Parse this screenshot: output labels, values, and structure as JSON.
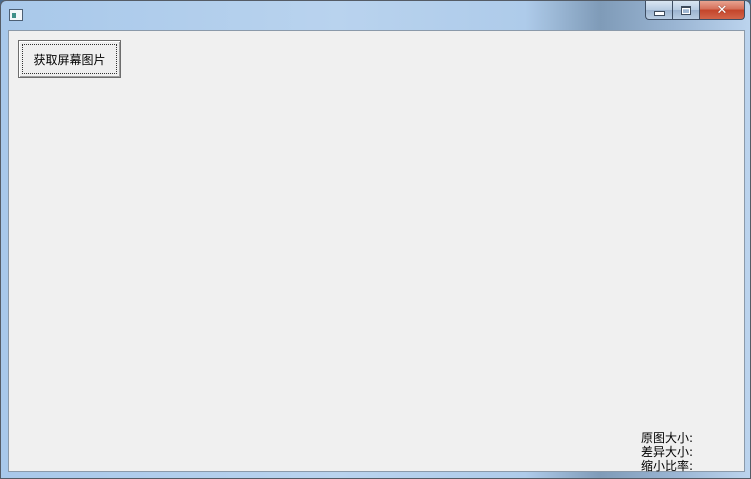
{
  "window": {
    "title": "",
    "caption_buttons": {
      "minimize_icon": "minimize-icon",
      "maximize_icon": "maximize-icon",
      "close_icon": "close-icon",
      "close_glyph": "✕"
    }
  },
  "toolbar": {
    "capture_label": "获取屏幕图片"
  },
  "info": {
    "original_size_label": "原图大小:",
    "diff_size_label": "差异大小:",
    "shrink_ratio_label": "缩小比率:"
  },
  "colors": {
    "client_background": "#f0f0f0",
    "titlebar": "#b9d3ee",
    "close_button": "#c3442a"
  }
}
